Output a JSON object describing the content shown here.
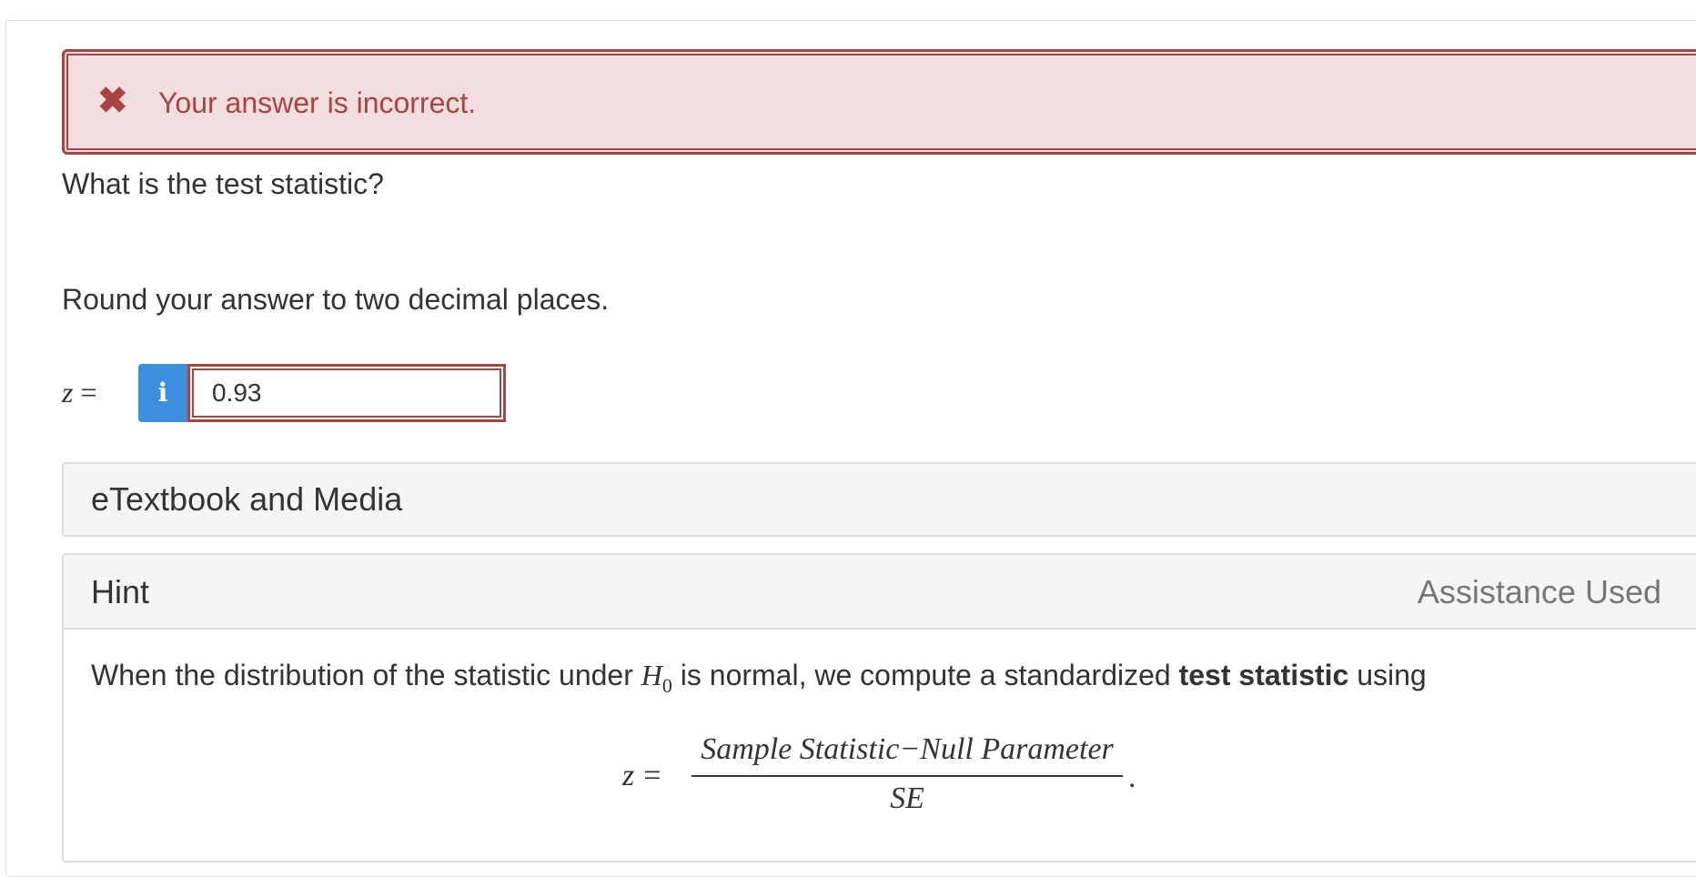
{
  "feedback": {
    "icon": "x-mark-icon",
    "message": "Your answer is incorrect.",
    "color": "#a94442",
    "background": "#f2dede"
  },
  "question": {
    "prompt": "What is the test statistic?",
    "instruction": "Round your answer to two decimal places."
  },
  "answer": {
    "variable": "z",
    "equals": "=",
    "info_icon": "i",
    "value": "0.93",
    "info_button_color": "#3b8fdc"
  },
  "etextbook": {
    "title": "eTextbook and Media"
  },
  "hint": {
    "title": "Hint",
    "status": "Assistance Used",
    "text_before": "When the distribution of the statistic under ",
    "h_symbol": "H",
    "h_subscript": "0",
    "text_middle": " is normal, we compute a standardized ",
    "bold_term": "test statistic",
    "text_after": " using",
    "formula": {
      "lhs": "z",
      "equals": "=",
      "numerator": "Sample Statistic−Null Parameter",
      "denominator": "SE",
      "trailing": "."
    }
  }
}
